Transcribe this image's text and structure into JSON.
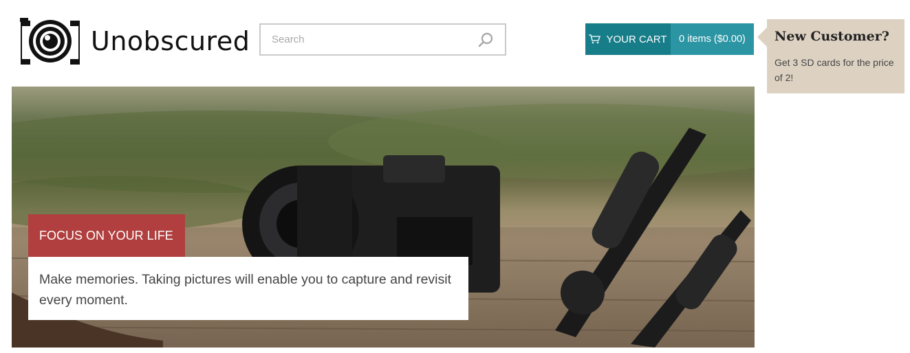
{
  "brand": {
    "name": "Unobscured",
    "logo_icon": "camera-logo-icon"
  },
  "search": {
    "placeholder": "Search",
    "value": "",
    "icon": "search-icon"
  },
  "cart": {
    "label": "YOUR CART",
    "items_text": "0 items ($0.00)",
    "icon": "cart-icon",
    "colors": {
      "button": "#177d88",
      "items": "#2b95a3"
    }
  },
  "promo": {
    "title": "New Customer?",
    "text": "Get 3 SD cards for the price of 2!",
    "color": "#ddd2c2"
  },
  "hero": {
    "caption_title": "FOCUS ON YOUR LIFE",
    "caption_text": "Make memories. Taking pictures will enable you to capture and revisit every moment.",
    "caption_color": "#b13f3f"
  }
}
